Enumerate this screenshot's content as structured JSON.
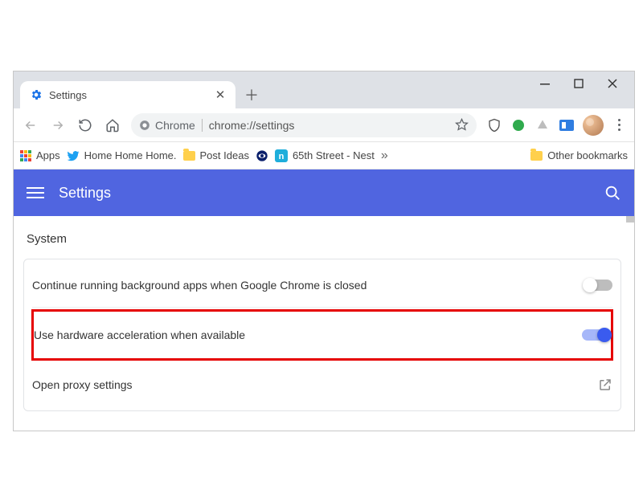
{
  "tab": {
    "title": "Settings"
  },
  "addr": {
    "label": "Chrome",
    "url": "chrome://settings"
  },
  "bookmarks": {
    "apps": "Apps",
    "home": "Home Home Home.",
    "post": "Post Ideas",
    "nest": "65th Street - Nest",
    "other": "Other bookmarks"
  },
  "header": {
    "title": "Settings"
  },
  "section": {
    "title": "System"
  },
  "rows": {
    "bg": "Continue running background apps when Google Chrome is closed",
    "hw": "Use hardware acceleration when available",
    "proxy": "Open proxy settings"
  }
}
